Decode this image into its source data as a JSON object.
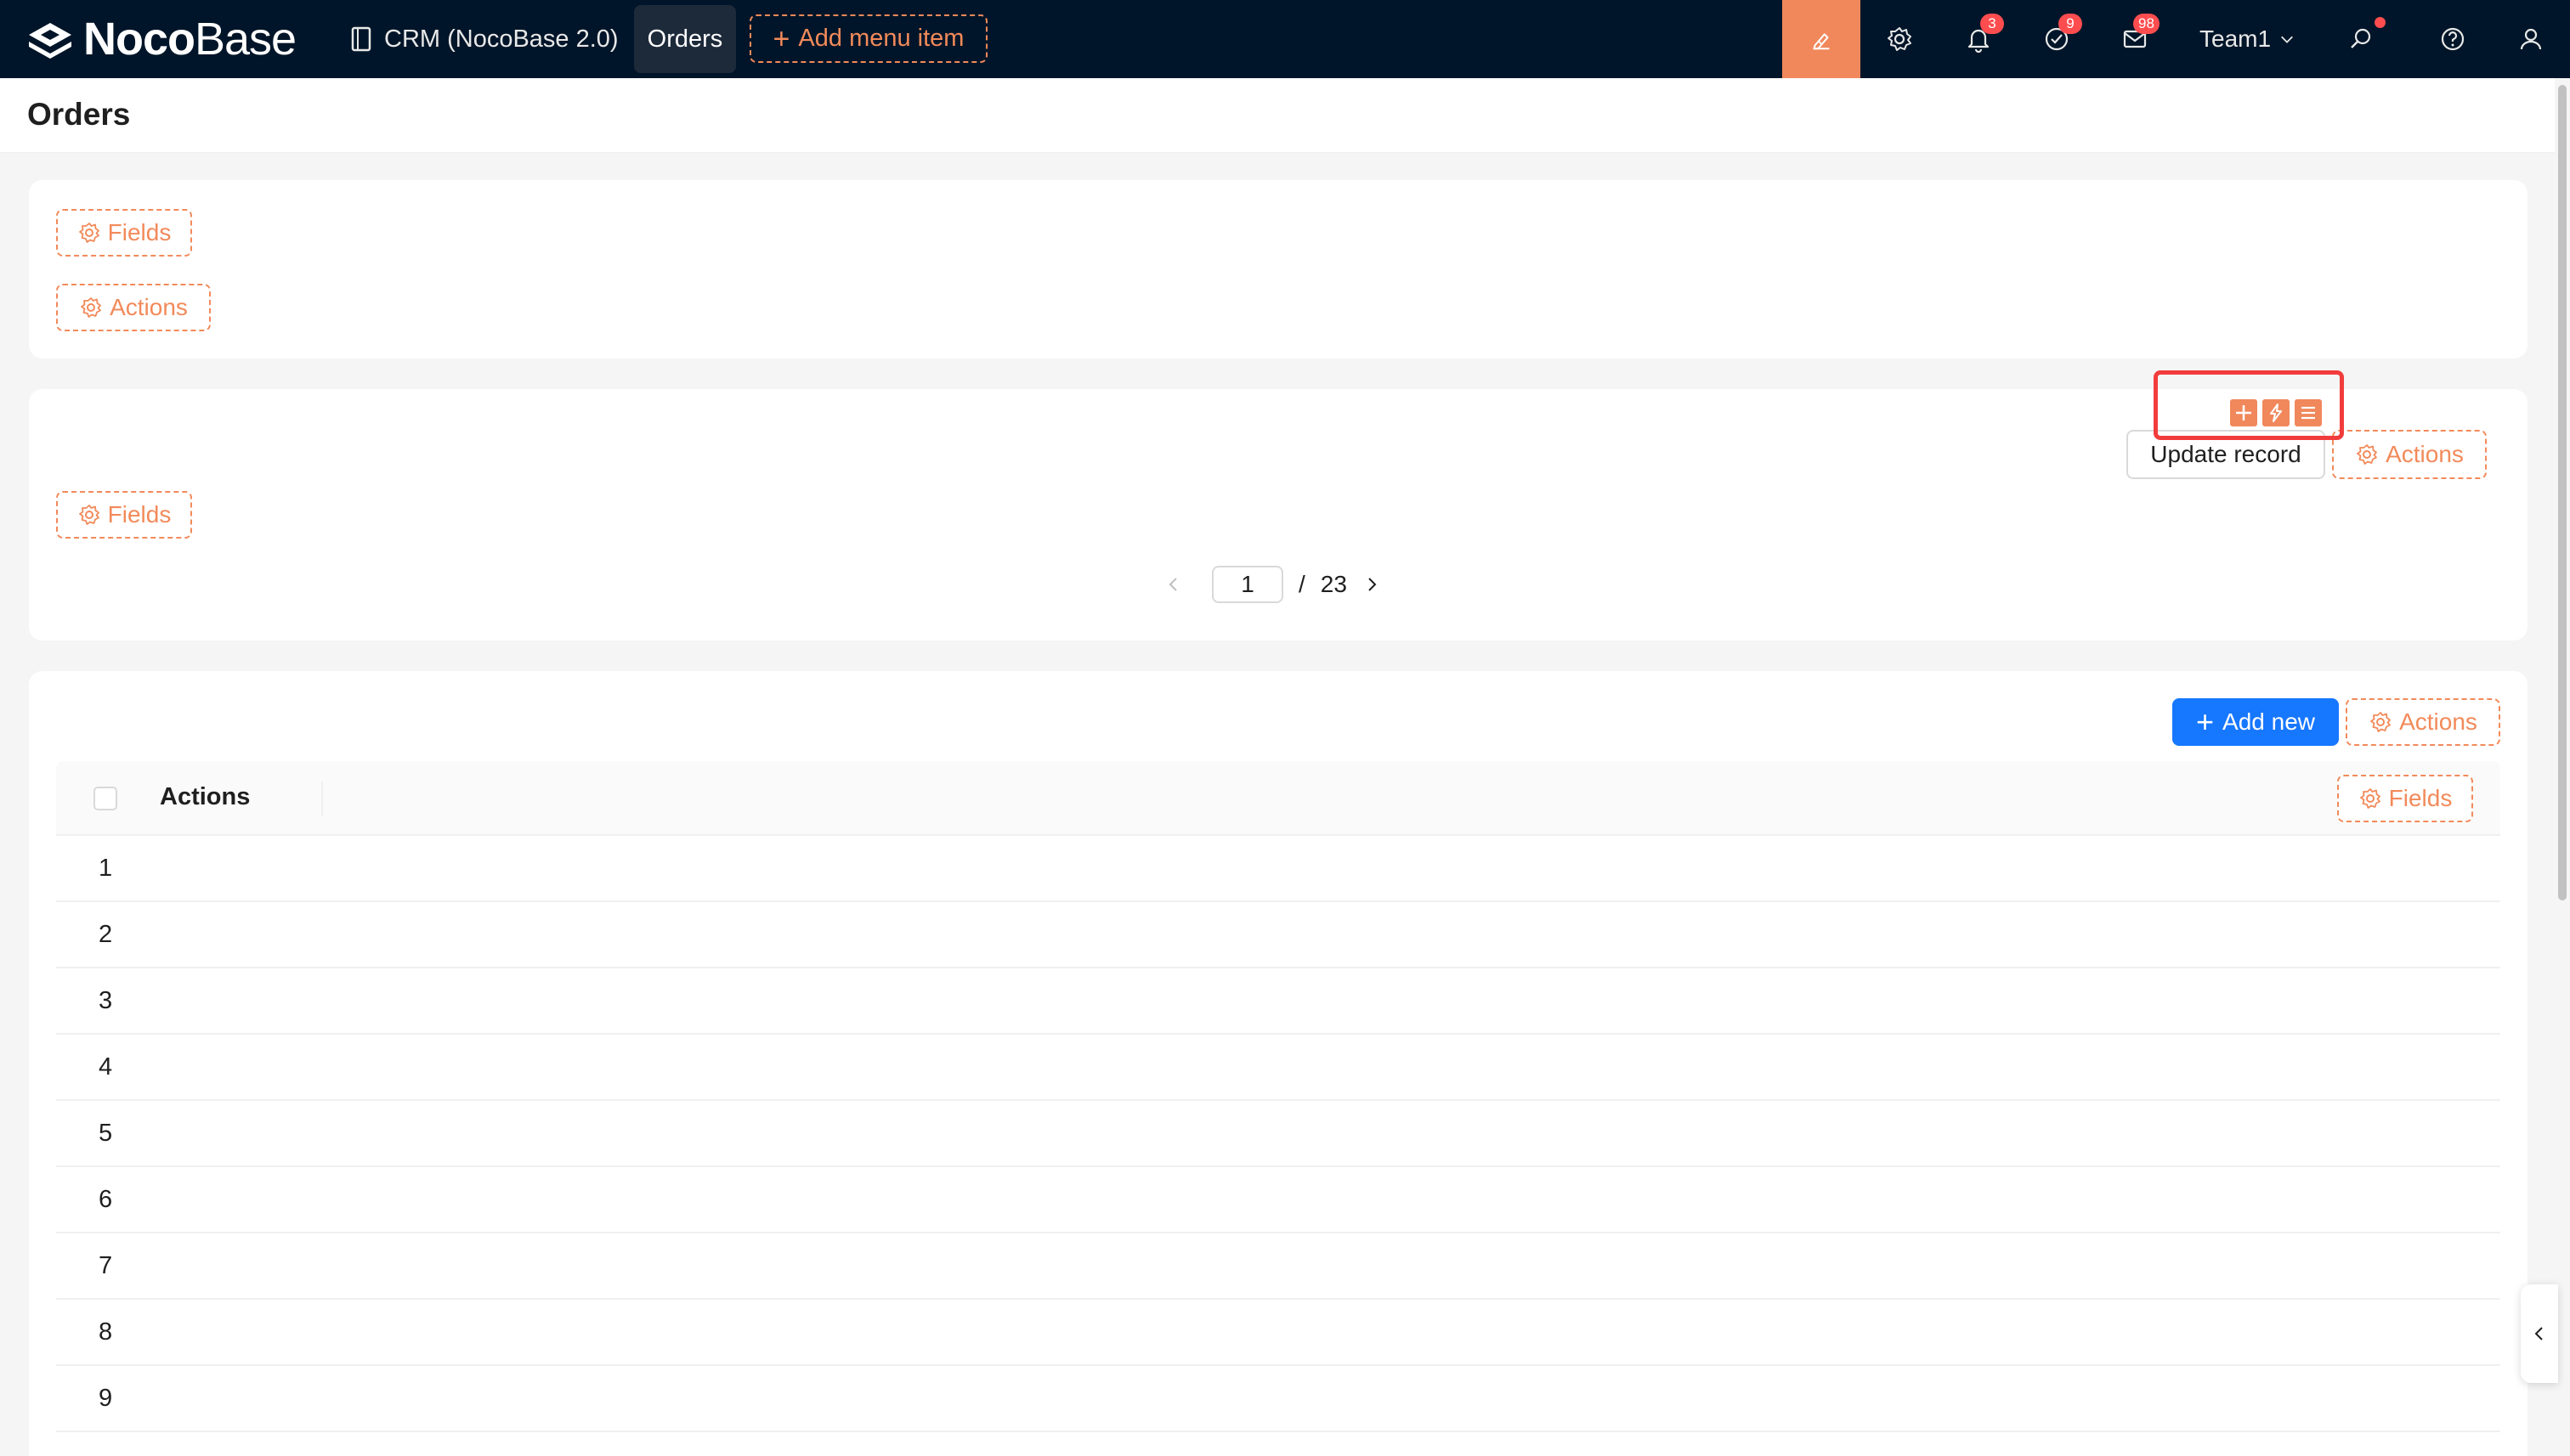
{
  "topbar": {
    "logo_bold": "Noco",
    "logo_light": "Base",
    "crm_label": "CRM (NocoBase 2.0)",
    "orders_label": "Orders",
    "add_menu_label": "Add menu item",
    "badges": {
      "notifications": "3",
      "tasks": "9",
      "mail": "98"
    },
    "team_label": "Team1",
    "accent_color": "#f0885c",
    "icons": [
      "ui-editor-icon",
      "gear-icon",
      "bell-icon",
      "check-circle-icon",
      "mail-icon",
      "search-icon",
      "help-icon",
      "user-icon"
    ]
  },
  "page": {
    "title": "Orders"
  },
  "block1": {
    "fields_label": "Fields",
    "actions_label": "Actions"
  },
  "block2": {
    "update_record_label": "Update record",
    "actions_label": "Actions",
    "fields_label": "Fields",
    "pager": {
      "current": "1",
      "separator": "/",
      "total": "23"
    }
  },
  "block3": {
    "add_new_label": "Add new",
    "actions_label": "Actions",
    "fields_label": "Fields",
    "column_actions": "Actions",
    "rows": [
      "1",
      "2",
      "3",
      "4",
      "5",
      "6",
      "7",
      "8",
      "9"
    ]
  }
}
